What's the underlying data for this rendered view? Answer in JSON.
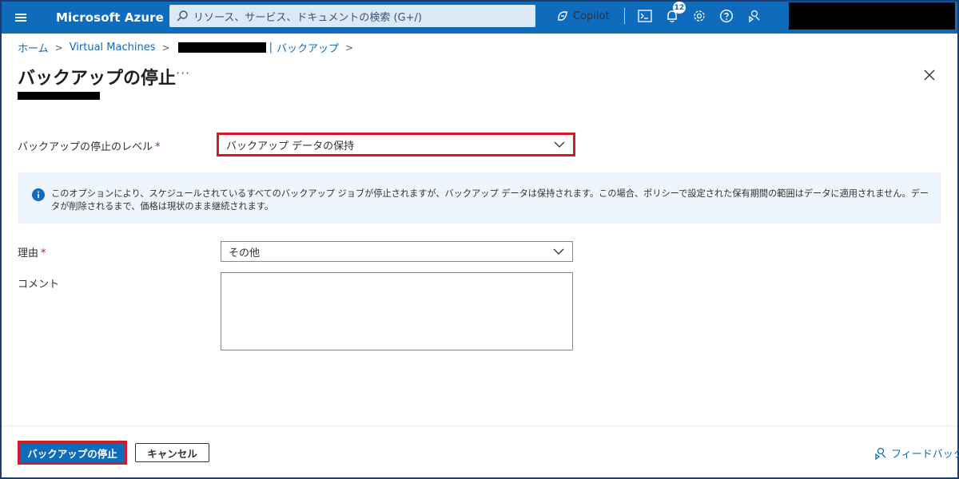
{
  "topbar": {
    "brand": "Microsoft Azure",
    "search_placeholder": "リソース、サービス、ドキュメントの検索 (G+/)",
    "copilot_label": "Copilot",
    "notification_count": "12",
    "icons": [
      "menu-icon",
      "search-icon",
      "copilot-icon",
      "cloud-shell-icon",
      "notifications-icon",
      "settings-icon",
      "help-icon",
      "feedback-icon"
    ]
  },
  "breadcrumb": {
    "home": "ホーム",
    "vms": "Virtual Machines",
    "backup": "バックアップ"
  },
  "page": {
    "title": "バックアップの停止",
    "more": "···"
  },
  "form": {
    "level_label": "バックアップの停止のレベル",
    "level_value": "バックアップ データの保持",
    "info_text": "このオプションにより、スケジュールされているすべてのバックアップ ジョブが停止されますが、バックアップ データは保持されます。この場合、ポリシーで設定された保有期間の範囲はデータに適用されません。データが削除されるまで、価格は現状のまま継続されます。",
    "reason_label": "理由",
    "reason_value": "その他",
    "comment_label": "コメント",
    "required_mark": "*"
  },
  "footer": {
    "stop_button": "バックアップの停止",
    "cancel_button": "キャンセル",
    "feedback_link": "フィードバック"
  },
  "colors": {
    "brand_blue": "#0f6cbd",
    "highlight_red": "#d01b2b",
    "info_bg": "#eff5fc"
  }
}
